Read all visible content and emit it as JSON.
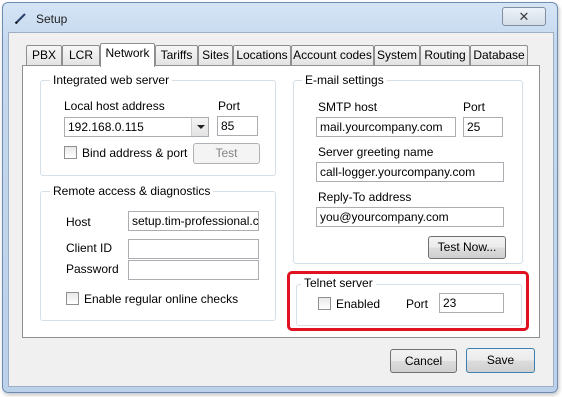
{
  "window": {
    "title": "Setup",
    "close_glyph": "✕"
  },
  "tabs": [
    {
      "label": "PBX"
    },
    {
      "label": "LCR"
    },
    {
      "label": "Network"
    },
    {
      "label": "Tariffs"
    },
    {
      "label": "Sites"
    },
    {
      "label": "Locations"
    },
    {
      "label": "Account codes"
    },
    {
      "label": "System"
    },
    {
      "label": "Routing"
    },
    {
      "label": "Database"
    }
  ],
  "active_tab": "Network",
  "web_server": {
    "title": "Integrated web server",
    "host_label": "Local host address",
    "host_value": "192.168.0.115",
    "port_label": "Port",
    "port_value": "85",
    "bind_label": "Bind address & port",
    "bind_checked": false,
    "test_label": "Test"
  },
  "remote": {
    "title": "Remote access & diagnostics",
    "host_label": "Host",
    "host_value": "setup.tim-professional.com",
    "client_label": "Client ID",
    "client_value": "",
    "password_label": "Password",
    "password_value": "",
    "checks_label": "Enable regular online checks",
    "checks_checked": false
  },
  "email": {
    "title": "E-mail settings",
    "smtp_label": "SMTP host",
    "smtp_value": "mail.yourcompany.com",
    "port_label": "Port",
    "port_value": "25",
    "greeting_label": "Server greeting name",
    "greeting_value": "call-logger.yourcompany.com",
    "reply_label": "Reply-To address",
    "reply_value": "you@yourcompany.com",
    "test_label": "Test Now..."
  },
  "telnet": {
    "title": "Telnet server",
    "enabled_label": "Enabled",
    "enabled_checked": false,
    "port_label": "Port",
    "port_value": "23"
  },
  "footer": {
    "cancel_label": "Cancel",
    "save_label": "Save"
  },
  "colors": {
    "highlight": "#e0121f",
    "frame": "#bcd1ea"
  },
  "icons": {
    "title_icon": "pencil-icon",
    "close_icon": "close-icon",
    "combo_icon": "chevron-down-icon"
  }
}
